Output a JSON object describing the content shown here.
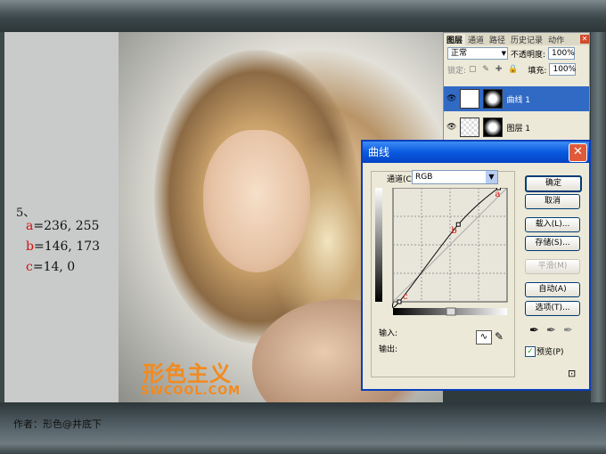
{
  "notes": {
    "step": "5、",
    "values": [
      {
        "key": "a",
        "text": "=236, 255"
      },
      {
        "key": "b",
        "text": "=146, 173"
      },
      {
        "key": "c",
        "text": "=14, 0"
      }
    ],
    "author": "作者：形色@井底下"
  },
  "watermark": {
    "line1": "形色主义",
    "line2": "SWCOOL.COM"
  },
  "layers_panel": {
    "tabs": [
      "图层",
      "通道",
      "路径",
      "历史记录",
      "动作"
    ],
    "blend_mode": "正常",
    "opacity_label": "不透明度:",
    "opacity_value": "100%",
    "lock_label": "锁定:",
    "fill_label": "填充:",
    "fill_value": "100%",
    "layers": [
      "曲线 1",
      "图层 1"
    ]
  },
  "curves_dialog": {
    "title": "曲线",
    "channel_label": "通道(C):",
    "channel_value": "RGB",
    "input_label": "输入:",
    "output_label": "输出:",
    "buttons": {
      "ok": "确定",
      "cancel": "取消",
      "load": "载入(L)...",
      "save": "存储(S)...",
      "smooth": "平滑(M)",
      "auto": "自动(A)",
      "options": "选项(T)..."
    },
    "preview_label": "预览(P)",
    "points": [
      {
        "name": "a",
        "input": 236,
        "output": 255
      },
      {
        "name": "b",
        "input": 146,
        "output": 173
      },
      {
        "name": "c",
        "input": 14,
        "output": 0
      }
    ],
    "colors": {
      "curve": "#000000",
      "point_label": "#d11010"
    }
  }
}
